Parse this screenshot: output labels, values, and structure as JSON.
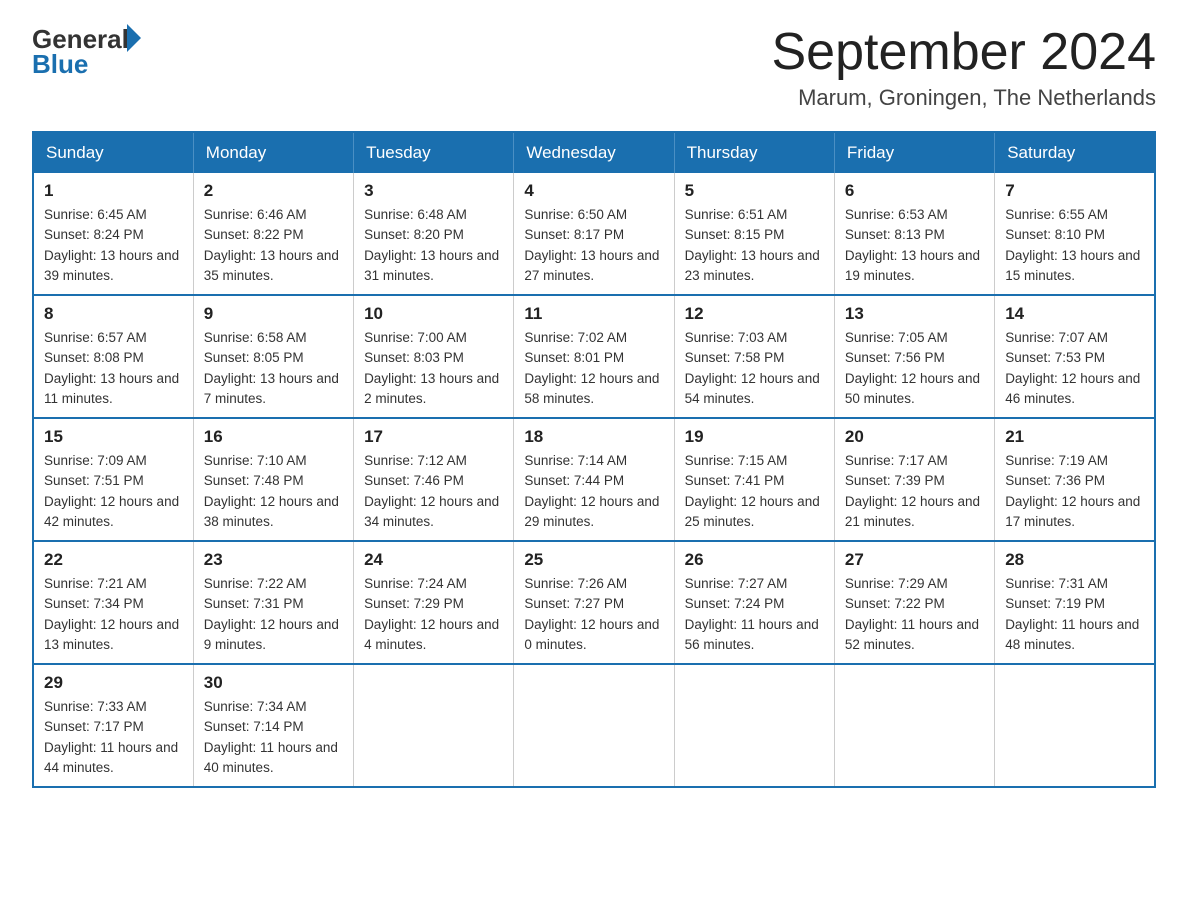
{
  "logo": {
    "general": "General",
    "blue": "Blue"
  },
  "title": "September 2024",
  "location": "Marum, Groningen, The Netherlands",
  "days_of_week": [
    "Sunday",
    "Monday",
    "Tuesday",
    "Wednesday",
    "Thursday",
    "Friday",
    "Saturday"
  ],
  "weeks": [
    [
      {
        "day": "1",
        "sunrise": "6:45 AM",
        "sunset": "8:24 PM",
        "daylight": "13 hours and 39 minutes."
      },
      {
        "day": "2",
        "sunrise": "6:46 AM",
        "sunset": "8:22 PM",
        "daylight": "13 hours and 35 minutes."
      },
      {
        "day": "3",
        "sunrise": "6:48 AM",
        "sunset": "8:20 PM",
        "daylight": "13 hours and 31 minutes."
      },
      {
        "day": "4",
        "sunrise": "6:50 AM",
        "sunset": "8:17 PM",
        "daylight": "13 hours and 27 minutes."
      },
      {
        "day": "5",
        "sunrise": "6:51 AM",
        "sunset": "8:15 PM",
        "daylight": "13 hours and 23 minutes."
      },
      {
        "day": "6",
        "sunrise": "6:53 AM",
        "sunset": "8:13 PM",
        "daylight": "13 hours and 19 minutes."
      },
      {
        "day": "7",
        "sunrise": "6:55 AM",
        "sunset": "8:10 PM",
        "daylight": "13 hours and 15 minutes."
      }
    ],
    [
      {
        "day": "8",
        "sunrise": "6:57 AM",
        "sunset": "8:08 PM",
        "daylight": "13 hours and 11 minutes."
      },
      {
        "day": "9",
        "sunrise": "6:58 AM",
        "sunset": "8:05 PM",
        "daylight": "13 hours and 7 minutes."
      },
      {
        "day": "10",
        "sunrise": "7:00 AM",
        "sunset": "8:03 PM",
        "daylight": "13 hours and 2 minutes."
      },
      {
        "day": "11",
        "sunrise": "7:02 AM",
        "sunset": "8:01 PM",
        "daylight": "12 hours and 58 minutes."
      },
      {
        "day": "12",
        "sunrise": "7:03 AM",
        "sunset": "7:58 PM",
        "daylight": "12 hours and 54 minutes."
      },
      {
        "day": "13",
        "sunrise": "7:05 AM",
        "sunset": "7:56 PM",
        "daylight": "12 hours and 50 minutes."
      },
      {
        "day": "14",
        "sunrise": "7:07 AM",
        "sunset": "7:53 PM",
        "daylight": "12 hours and 46 minutes."
      }
    ],
    [
      {
        "day": "15",
        "sunrise": "7:09 AM",
        "sunset": "7:51 PM",
        "daylight": "12 hours and 42 minutes."
      },
      {
        "day": "16",
        "sunrise": "7:10 AM",
        "sunset": "7:48 PM",
        "daylight": "12 hours and 38 minutes."
      },
      {
        "day": "17",
        "sunrise": "7:12 AM",
        "sunset": "7:46 PM",
        "daylight": "12 hours and 34 minutes."
      },
      {
        "day": "18",
        "sunrise": "7:14 AM",
        "sunset": "7:44 PM",
        "daylight": "12 hours and 29 minutes."
      },
      {
        "day": "19",
        "sunrise": "7:15 AM",
        "sunset": "7:41 PM",
        "daylight": "12 hours and 25 minutes."
      },
      {
        "day": "20",
        "sunrise": "7:17 AM",
        "sunset": "7:39 PM",
        "daylight": "12 hours and 21 minutes."
      },
      {
        "day": "21",
        "sunrise": "7:19 AM",
        "sunset": "7:36 PM",
        "daylight": "12 hours and 17 minutes."
      }
    ],
    [
      {
        "day": "22",
        "sunrise": "7:21 AM",
        "sunset": "7:34 PM",
        "daylight": "12 hours and 13 minutes."
      },
      {
        "day": "23",
        "sunrise": "7:22 AM",
        "sunset": "7:31 PM",
        "daylight": "12 hours and 9 minutes."
      },
      {
        "day": "24",
        "sunrise": "7:24 AM",
        "sunset": "7:29 PM",
        "daylight": "12 hours and 4 minutes."
      },
      {
        "day": "25",
        "sunrise": "7:26 AM",
        "sunset": "7:27 PM",
        "daylight": "12 hours and 0 minutes."
      },
      {
        "day": "26",
        "sunrise": "7:27 AM",
        "sunset": "7:24 PM",
        "daylight": "11 hours and 56 minutes."
      },
      {
        "day": "27",
        "sunrise": "7:29 AM",
        "sunset": "7:22 PM",
        "daylight": "11 hours and 52 minutes."
      },
      {
        "day": "28",
        "sunrise": "7:31 AM",
        "sunset": "7:19 PM",
        "daylight": "11 hours and 48 minutes."
      }
    ],
    [
      {
        "day": "29",
        "sunrise": "7:33 AM",
        "sunset": "7:17 PM",
        "daylight": "11 hours and 44 minutes."
      },
      {
        "day": "30",
        "sunrise": "7:34 AM",
        "sunset": "7:14 PM",
        "daylight": "11 hours and 40 minutes."
      },
      null,
      null,
      null,
      null,
      null
    ]
  ]
}
